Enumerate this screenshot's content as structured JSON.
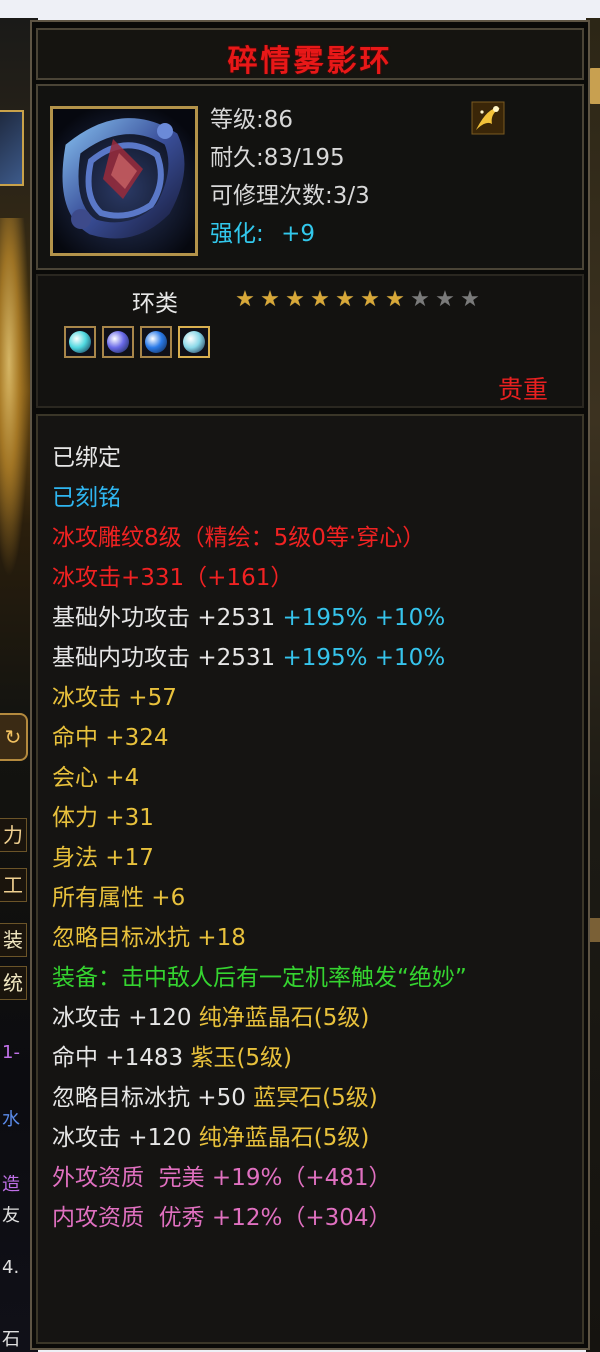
{
  "item": {
    "name": "碎情雾影环",
    "level": "等级:86",
    "durability": "耐久:83/195",
    "repair": "可修理次数:3/3",
    "enhance_label": "强化:",
    "enhance_value": "+9",
    "type": "环类",
    "stars_total": 10,
    "stars_lit": 7,
    "rarity": "贵重"
  },
  "gems": [
    {
      "name": "cyan-gem",
      "color": "#4fd8e0"
    },
    {
      "name": "violet-gem",
      "color": "#6a6ae8"
    },
    {
      "name": "blue-gem",
      "color": "#2a7ae8"
    },
    {
      "name": "ice-gem",
      "color": "#8ad8e8"
    }
  ],
  "attributes": {
    "bound": "已绑定",
    "engraved": "已刻铭",
    "engrave_pattern": "冰攻雕纹8级（精绘：5级0等·穿心）",
    "ice_attack_total": "冰攻击+331（+161）",
    "base_outer": {
      "label": "基础外功攻击",
      "value": "+2531",
      "pct1": "+195%",
      "pct2": "+10%"
    },
    "base_inner": {
      "label": "基础内功攻击",
      "value": "+2531",
      "pct1": "+195%",
      "pct2": "+10%"
    },
    "yellow": [
      "冰攻击 +57",
      "命中 +324",
      "会心 +4",
      "体力 +31",
      "身法 +17",
      "所有属性 +6",
      "忽略目标冰抗 +18"
    ],
    "set_effect": "装备：击中敌人后有一定机率触发“绝妙”",
    "gem_lines": [
      {
        "stat": "冰攻击 +120",
        "gem": "纯净蓝晶石",
        "lvl": "(5级)"
      },
      {
        "stat": "命中 +1483",
        "gem": "紫玉",
        "lvl": "(5级)"
      },
      {
        "stat": "忽略目标冰抗 +50",
        "gem": "蓝冥石",
        "lvl": "(5级)"
      },
      {
        "stat": "冰攻击 +120",
        "gem": "纯净蓝晶石",
        "lvl": "(5级)"
      }
    ],
    "outer_quality": "外攻资质  完美 +19%（+481）",
    "inner_quality": "内攻资质  优秀 +12%（+304）"
  },
  "background": {
    "tags": [
      "力",
      "工",
      "装",
      "统"
    ],
    "fragments": [
      "1-",
      "水",
      "造",
      "友",
      "4.",
      "石"
    ]
  }
}
